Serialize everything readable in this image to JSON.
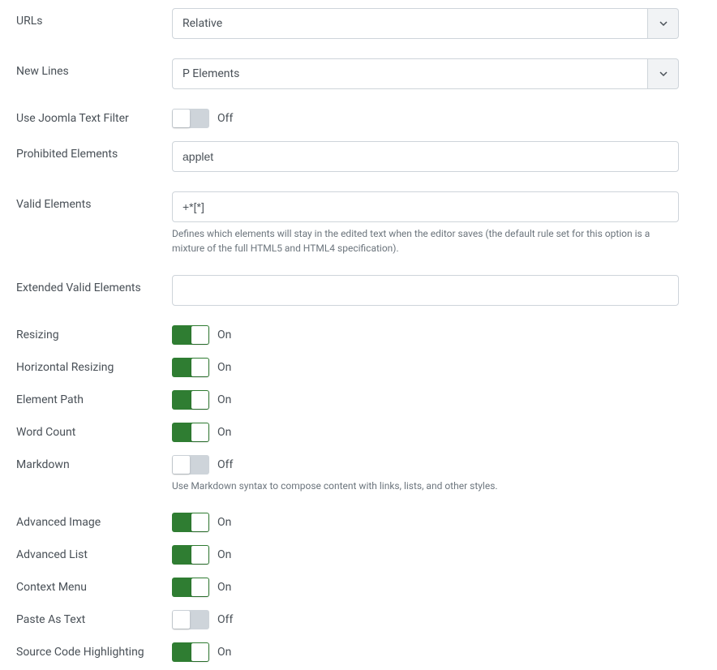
{
  "urls": {
    "label": "URLs",
    "value": "Relative"
  },
  "newlines": {
    "label": "New Lines",
    "value": "P Elements"
  },
  "joomlaFilter": {
    "label": "Use Joomla Text Filter",
    "state": "Off"
  },
  "prohibited": {
    "label": "Prohibited Elements",
    "value": "applet"
  },
  "validElements": {
    "label": "Valid Elements",
    "value": "+*[*]",
    "help": "Defines which elements will stay in the edited text when the editor saves (the default rule set for this option is a mixture of the full HTML5 and HTML4 specification)."
  },
  "extendedValid": {
    "label": "Extended Valid Elements",
    "value": ""
  },
  "resizing": {
    "label": "Resizing",
    "state": "On"
  },
  "horizontalResizing": {
    "label": "Horizontal Resizing",
    "state": "On"
  },
  "elementPath": {
    "label": "Element Path",
    "state": "On"
  },
  "wordCount": {
    "label": "Word Count",
    "state": "On"
  },
  "markdown": {
    "label": "Markdown",
    "state": "Off",
    "help": "Use Markdown syntax to compose content with links, lists, and other styles."
  },
  "advancedImage": {
    "label": "Advanced Image",
    "state": "On"
  },
  "advancedList": {
    "label": "Advanced List",
    "state": "On"
  },
  "contextMenu": {
    "label": "Context Menu",
    "state": "On"
  },
  "pasteAsText": {
    "label": "Paste As Text",
    "state": "Off"
  },
  "sourceCodeHighlighting": {
    "label": "Source Code Highlighting",
    "state": "On"
  }
}
